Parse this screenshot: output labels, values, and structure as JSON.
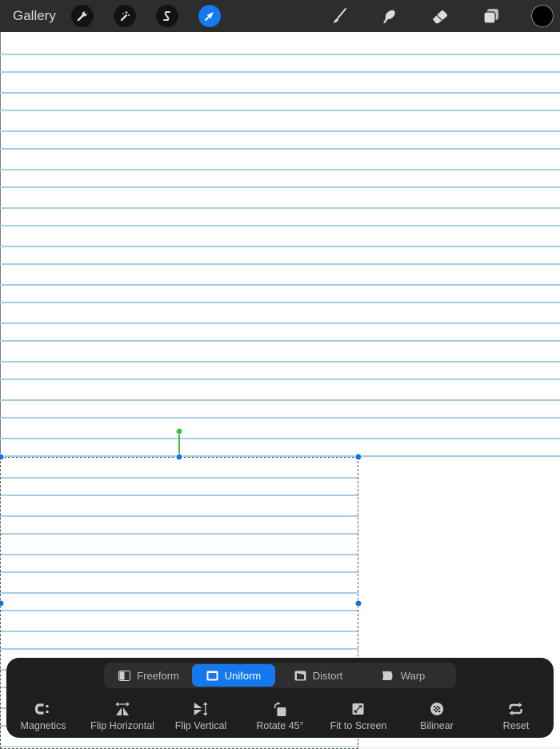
{
  "topbar": {
    "gallery_label": "Gallery",
    "left_tools": [
      {
        "name": "actions",
        "icon": "wrench-icon",
        "active": false
      },
      {
        "name": "adjustments",
        "icon": "magic-wand-icon",
        "active": false
      },
      {
        "name": "selection",
        "icon": "selection-s-icon",
        "active": false
      },
      {
        "name": "transform",
        "icon": "arrow-cursor-icon",
        "active": true
      }
    ],
    "right_tools": [
      {
        "name": "brush",
        "icon": "brush-icon"
      },
      {
        "name": "smudge",
        "icon": "smudge-finger-icon"
      },
      {
        "name": "eraser",
        "icon": "eraser-icon"
      },
      {
        "name": "layers",
        "icon": "layers-icon"
      }
    ],
    "current_color": "#000000",
    "accent_color": "#1478f0"
  },
  "transform_panel": {
    "modes": [
      {
        "label": "Freeform",
        "icon": "freeform-icon",
        "active": false
      },
      {
        "label": "Uniform",
        "icon": "uniform-icon",
        "active": true
      },
      {
        "label": "Distort",
        "icon": "distort-icon",
        "active": false
      },
      {
        "label": "Warp",
        "icon": "warp-icon",
        "active": false
      }
    ],
    "tools": [
      {
        "label": "Magnetics",
        "icon": "magnet-icon"
      },
      {
        "label": "Flip Horizontal",
        "icon": "flip-horizontal-icon"
      },
      {
        "label": "Flip Vertical",
        "icon": "flip-vertical-icon"
      },
      {
        "label": "Rotate 45°",
        "icon": "rotate-icon"
      },
      {
        "label": "Fit to Screen",
        "icon": "fit-to-screen-icon"
      },
      {
        "label": "Bilinear",
        "icon": "bilinear-icon"
      },
      {
        "label": "Reset",
        "icon": "reset-icon"
      }
    ]
  }
}
